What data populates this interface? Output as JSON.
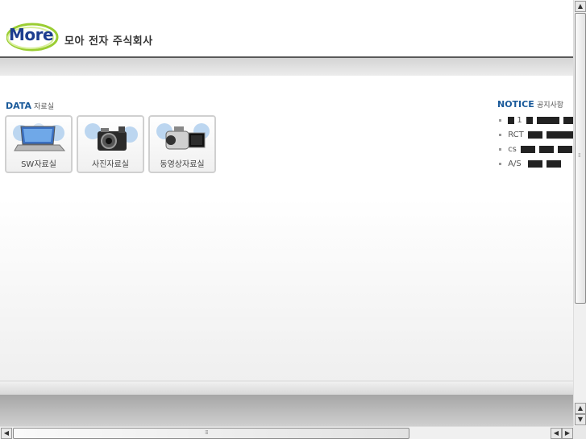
{
  "header": {
    "logo_text": "More",
    "company_name": "모아 전자 주식회사"
  },
  "data_section": {
    "title_en": "DATA",
    "title_ko": "자료실",
    "items": [
      {
        "label": "SW자료실",
        "icon": "laptop-icon"
      },
      {
        "label": "사진자료실",
        "icon": "camera-icon"
      },
      {
        "label": "동영상자료실",
        "icon": "camcorder-icon"
      }
    ]
  },
  "notice_section": {
    "title_en": "NOTICE",
    "title_ko": "공지사항",
    "items": [
      {
        "prefix": "1"
      },
      {
        "prefix": "RCT"
      },
      {
        "prefix": "cs"
      },
      {
        "prefix": "A/S"
      }
    ]
  },
  "scrollbars": {
    "up_arrow": "▲",
    "down_arrow": "▼",
    "left_arrow": "◀",
    "right_arrow": "▶"
  },
  "colors": {
    "logo_blue": "#1d3d8f",
    "logo_swoosh": "#9acd32",
    "section_title_blue": "#1a5a9a"
  }
}
